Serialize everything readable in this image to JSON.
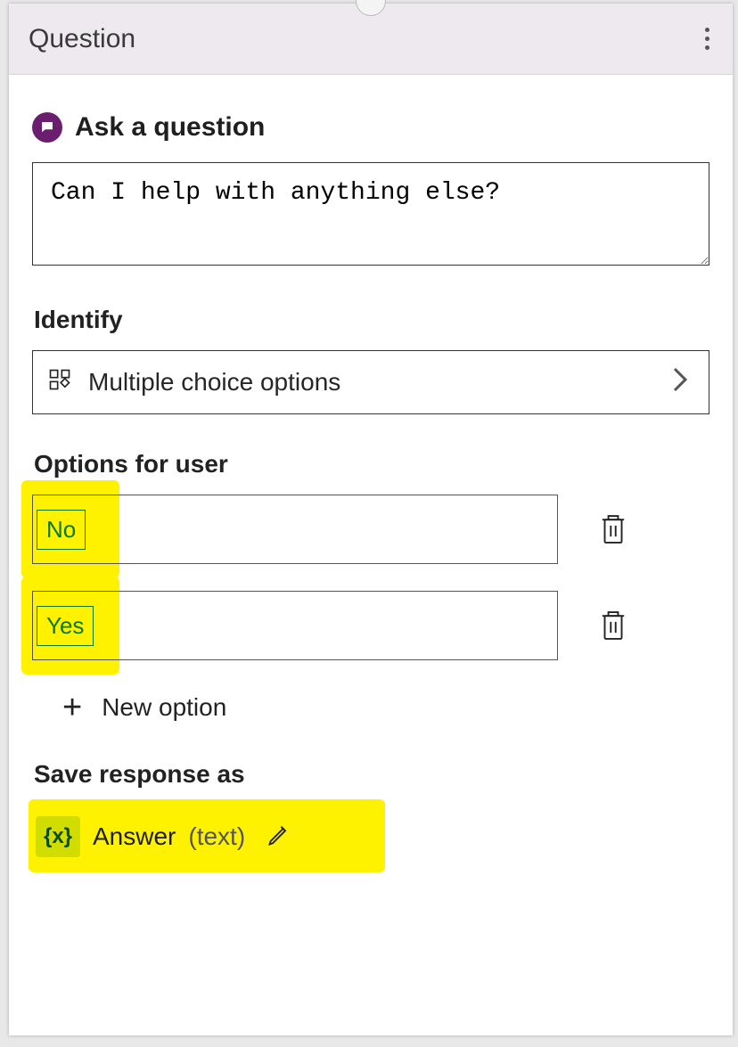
{
  "header": {
    "title": "Question"
  },
  "askSection": {
    "title": "Ask a question"
  },
  "questionInput": {
    "value": "Can I help with anything else?"
  },
  "identify": {
    "label": "Identify",
    "selected": "Multiple choice options"
  },
  "optionsSection": {
    "label": "Options for user"
  },
  "options": [
    {
      "label": "No"
    },
    {
      "label": "Yes"
    }
  ],
  "newOption": {
    "label": "New option"
  },
  "saveSection": {
    "label": "Save response as"
  },
  "variable": {
    "badge": "{x}",
    "name": "Answer",
    "type": "(text)"
  }
}
